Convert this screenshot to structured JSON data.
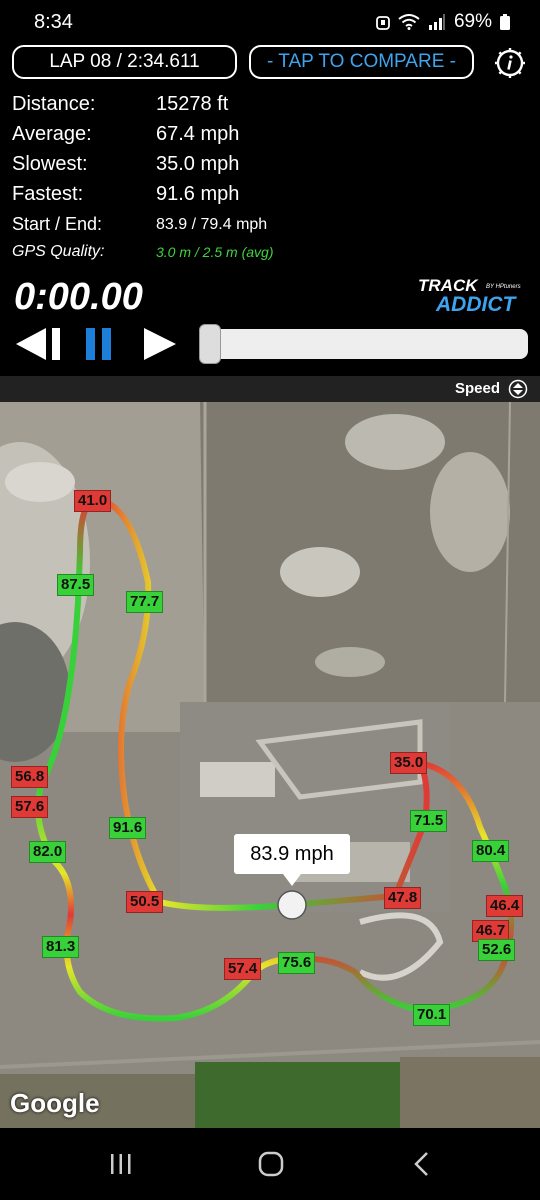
{
  "status_bar": {
    "time": "8:34",
    "battery": "69%"
  },
  "header": {
    "lap_label": "LAP 08 / 2:34.611",
    "compare_label": "- TAP TO COMPARE -"
  },
  "stats": [
    {
      "label": "Distance:",
      "value": "15278 ft"
    },
    {
      "label": "Average:",
      "value": "67.4 mph"
    },
    {
      "label": "Slowest:",
      "value": "35.0 mph"
    },
    {
      "label": "Fastest:",
      "value": "91.6 mph"
    },
    {
      "label": "Start / End:",
      "value": "83.9 / 79.4 mph"
    },
    {
      "label": "GPS Quality:",
      "value": "3.0 m / 2.5 m (avg)"
    }
  ],
  "playback": {
    "timer": "0:00.00",
    "progress": 0.0
  },
  "brand": {
    "line1": "TRACK",
    "line2": "ADDICT",
    "by": "BY HPtuners"
  },
  "map": {
    "layer_label": "Speed",
    "current_speed": "83.9 mph",
    "provider": "Google",
    "speed_labels": [
      {
        "text": "41.0",
        "level": "slow"
      },
      {
        "text": "87.5",
        "level": "fast"
      },
      {
        "text": "77.7",
        "level": "fast"
      },
      {
        "text": "56.8",
        "level": "slow"
      },
      {
        "text": "57.6",
        "level": "slow"
      },
      {
        "text": "82.0",
        "level": "fast"
      },
      {
        "text": "91.6",
        "level": "fast"
      },
      {
        "text": "50.5",
        "level": "slow"
      },
      {
        "text": "81.3",
        "level": "fast"
      },
      {
        "text": "57.4",
        "level": "slow"
      },
      {
        "text": "75.6",
        "level": "fast"
      },
      {
        "text": "47.8",
        "level": "slow"
      },
      {
        "text": "35.0",
        "level": "slow"
      },
      {
        "text": "71.5",
        "level": "fast"
      },
      {
        "text": "80.4",
        "level": "fast"
      },
      {
        "text": "46.4",
        "level": "slow"
      },
      {
        "text": "46.7",
        "level": "slow"
      },
      {
        "text": "52.6",
        "level": "fast"
      },
      {
        "text": "70.1",
        "level": "fast"
      }
    ]
  },
  "colors": {
    "slow": "#e03a36",
    "fast": "#38d13a",
    "mid": "#e6e62a",
    "accent": "#3ea4ee",
    "play_blue": "#1e7fd8"
  }
}
